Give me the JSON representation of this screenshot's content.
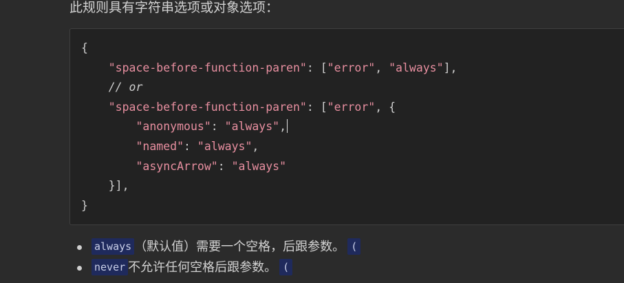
{
  "intro_text": "此规则具有字符串选项或对象选项：",
  "code": {
    "line1": "{",
    "line2_key": "\"space-before-function-paren\"",
    "line2_rest_a": ": [",
    "line2_val1": "\"error\"",
    "line2_rest_b": ", ",
    "line2_val2": "\"always\"",
    "line2_rest_c": "],",
    "line3_comment": "// or",
    "line4_key": "\"space-before-function-paren\"",
    "line4_rest_a": ": [",
    "line4_val1": "\"error\"",
    "line4_rest_b": ", {",
    "line5_key": "\"anonymous\"",
    "line5_sep": ": ",
    "line5_val": "\"always\"",
    "line5_end": ",",
    "line6_key": "\"named\"",
    "line6_sep": ": ",
    "line6_val": "\"always\"",
    "line6_end": ",",
    "line7_key": "\"asyncArrow\"",
    "line7_sep": ": ",
    "line7_val": "\"always\"",
    "line8": "}],",
    "line9": "}"
  },
  "bullets": [
    {
      "keyword": "always",
      "text": "（默认值）需要一个空格，后跟参数。",
      "paren": "("
    },
    {
      "keyword": "never",
      "text": "不允许任何空格后跟参数。",
      "paren": "("
    }
  ]
}
